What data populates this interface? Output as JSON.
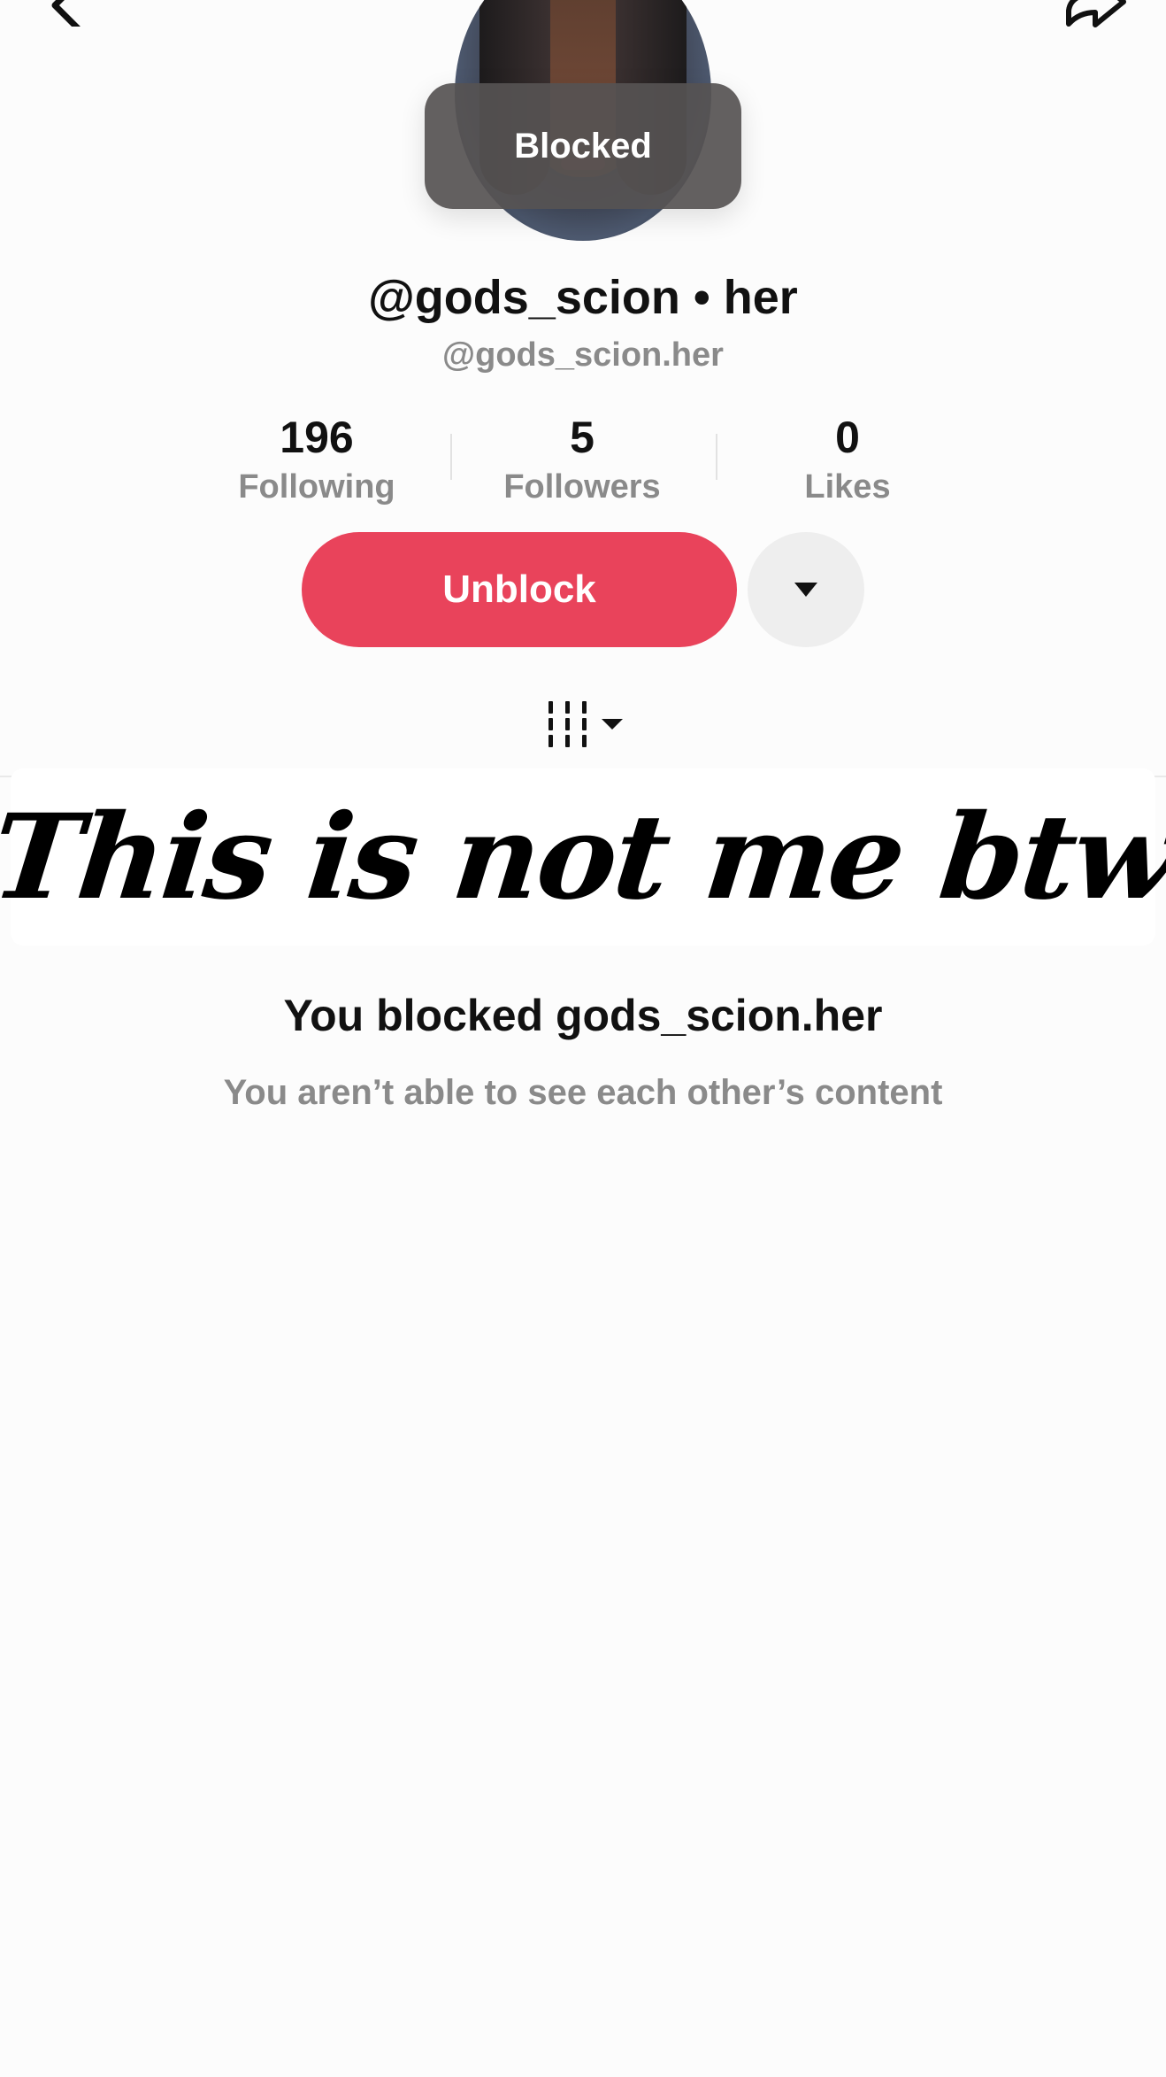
{
  "toast": {
    "text": "Blocked"
  },
  "profile": {
    "display_name": "@gods_scion • her",
    "username": "@gods_scion.her"
  },
  "stats": [
    {
      "value": "196",
      "label": "Following"
    },
    {
      "value": "5",
      "label": "Followers"
    },
    {
      "value": "0",
      "label": "Likes"
    }
  ],
  "actions": {
    "unblock_label": "Unblock",
    "more_icon": "caret-down-icon"
  },
  "tabs": {
    "videos_icon": "grid-tab-icon",
    "dropdown_icon": "caret-down-icon"
  },
  "banner": {
    "text": "This is not me btw"
  },
  "blocked_state": {
    "title": "You blocked gods_scion.her",
    "subtitle": "You aren’t able to see each other’s content"
  },
  "nav": {
    "back_icon": "back-arrow-icon",
    "share_icon": "share-icon"
  },
  "colors": {
    "accent": "#e9435b",
    "toast_bg": "#565252",
    "muted_text": "#8a8a8a"
  }
}
